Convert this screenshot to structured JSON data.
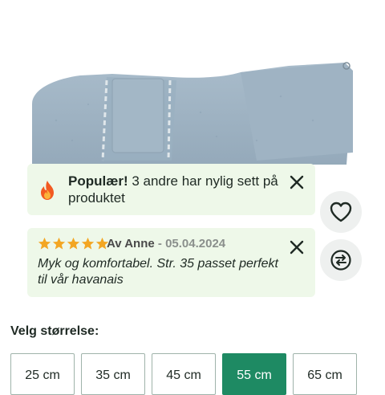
{
  "product_image": {
    "alt": "Dog bathrobe (grey)"
  },
  "popular_toast": {
    "icon": "fire-icon",
    "title": "Populær!",
    "text": " 3 andre har nylig sett på produktet"
  },
  "review_toast": {
    "rating": 5,
    "rating_max": 5,
    "author": "Av Anne",
    "separator": " - ",
    "date": "05.04.2024",
    "body": "Myk og komfortabel. Str. 35 passet perfekt til vår havanais"
  },
  "actions": {
    "wishlist_icon": "heart-icon",
    "compare_icon": "compare-arrows-icon"
  },
  "size": {
    "label": "Velg størrelse:",
    "selected": "55 cm",
    "options": [
      "25 cm",
      "35 cm",
      "45 cm",
      "55 cm",
      "65 cm"
    ]
  },
  "colors": {
    "toast_bg": "#eef8e9",
    "accent": "#1e8a63",
    "star": "#f3a623"
  }
}
